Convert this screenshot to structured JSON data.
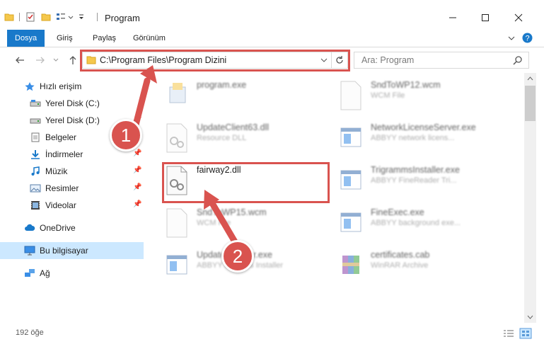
{
  "window": {
    "title": "Program"
  },
  "ribbon": {
    "tabs": [
      "Dosya",
      "Giriş",
      "Paylaş",
      "Görünüm"
    ]
  },
  "address": {
    "path": "C:\\Program Files\\Program Dizini"
  },
  "search": {
    "placeholder": "Ara: Program"
  },
  "sidebar": {
    "items": [
      {
        "label": "Hızlı erişim",
        "icon": "star-icon"
      },
      {
        "label": "Yerel Disk (C:)",
        "icon": "drive-icon"
      },
      {
        "label": "Yerel Disk (D:)",
        "icon": "drive-icon"
      },
      {
        "label": "Belgeler",
        "icon": "documents-icon"
      },
      {
        "label": "İndirmeler",
        "icon": "download-icon"
      },
      {
        "label": "Müzik",
        "icon": "music-icon"
      },
      {
        "label": "Resimler",
        "icon": "pictures-icon"
      },
      {
        "label": "Videolar",
        "icon": "video-icon"
      },
      {
        "label": "OneDrive",
        "icon": "cloud-icon"
      },
      {
        "label": "Bu bilgisayar",
        "icon": "computer-icon"
      },
      {
        "label": "Ağ",
        "icon": "network-icon"
      }
    ]
  },
  "files": {
    "left": [
      {
        "name": "program.exe",
        "desc": ""
      },
      {
        "name": "UpdateClient63.dll",
        "desc": "Resource DLL"
      },
      {
        "name": "fairway2.dll",
        "desc": ""
      },
      {
        "name": "SndToWP15.wcm",
        "desc": "WCM File"
      },
      {
        "name": "UpdateInstaller.exe",
        "desc": "ABBYY Updates Installer"
      }
    ],
    "right": [
      {
        "name": "SndToWP12.wcm",
        "desc": "WCM File"
      },
      {
        "name": "NetworkLicenseServer.exe",
        "desc": "ABBYY network licens..."
      },
      {
        "name": "TrigrammsInstaller.exe",
        "desc": "ABBYY FineReader Tri..."
      },
      {
        "name": "FineExec.exe",
        "desc": "ABBYY background exe..."
      },
      {
        "name": "certificates.cab",
        "desc": "WinRAR Archive"
      }
    ]
  },
  "status": {
    "count": "192 öğe"
  },
  "callouts": {
    "one": "1",
    "two": "2"
  },
  "colors": {
    "accent": "#1979ca",
    "callout": "#d9534f",
    "selected": "#cce8ff"
  }
}
